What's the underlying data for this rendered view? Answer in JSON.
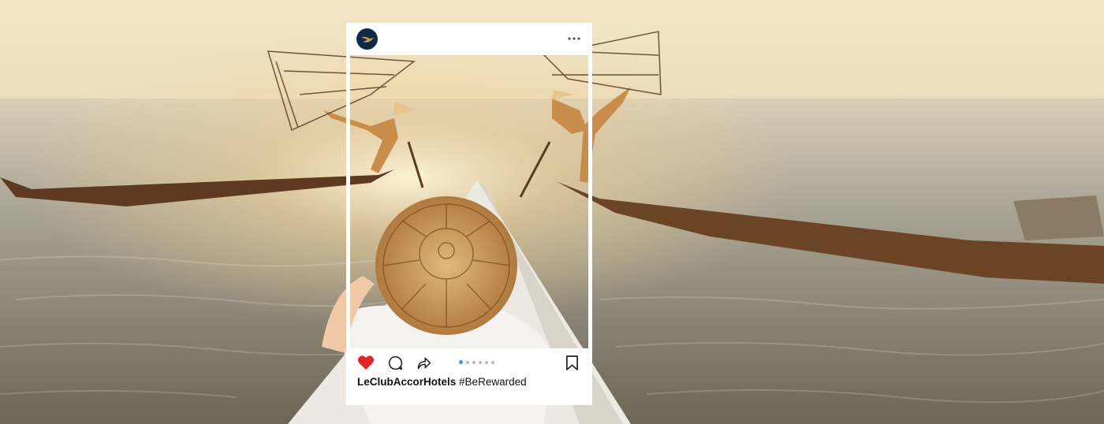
{
  "post": {
    "account_icon": "accor-bird-logo",
    "more_icon": "more-horizontal-icon",
    "actions": {
      "like_icon": "heart-filled-icon",
      "comment_icon": "comment-icon",
      "share_icon": "share-arrow-icon",
      "bookmark_icon": "bookmark-icon"
    },
    "carousel": {
      "count": 6,
      "active_index": 0
    },
    "caption": {
      "username": "LeClubAccorHotels",
      "hashtag": "#BeRewarded"
    }
  },
  "colors": {
    "like": "#e0252f",
    "brand_navy": "#0e2a47",
    "brand_gold": "#c9a04a",
    "carousel_active": "#3897f0"
  }
}
